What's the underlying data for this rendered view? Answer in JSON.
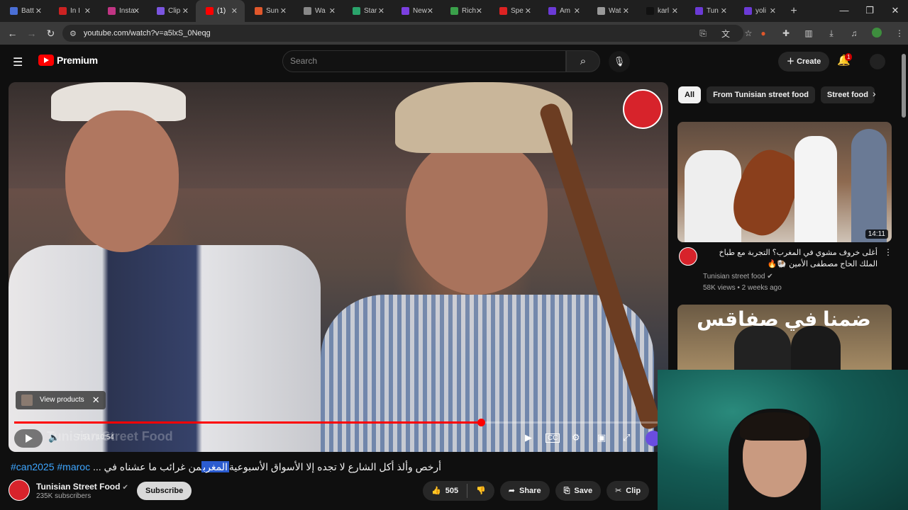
{
  "browser": {
    "tabs": [
      {
        "label": "Batt",
        "color": "#4a6fd6"
      },
      {
        "label": "In I",
        "color": "#cc2222"
      },
      {
        "label": "Insta",
        "color": "#c13584"
      },
      {
        "label": "Clip",
        "color": "#7b55e0"
      },
      {
        "label": "(1)",
        "color": "#ff0000",
        "active": true
      },
      {
        "label": "Sun",
        "color": "#e0572b"
      },
      {
        "label": "Wa",
        "color": "#888888"
      },
      {
        "label": "Star",
        "color": "#2aa36b"
      },
      {
        "label": "New",
        "color": "#7b3fe0"
      },
      {
        "label": "Rich",
        "color": "#3aa04a"
      },
      {
        "label": "Spe",
        "color": "#dd2222"
      },
      {
        "label": "Am",
        "color": "#6b3ad6"
      },
      {
        "label": "Wat",
        "color": "#999999"
      },
      {
        "label": "karl",
        "color": "#111111"
      },
      {
        "label": "Tun",
        "color": "#6b3ad6"
      },
      {
        "label": "yoli",
        "color": "#6b3ad6"
      }
    ],
    "url": "youtube.com/watch?v=a5lxS_0Neqg"
  },
  "youtube": {
    "logo_text": "Premium",
    "search_placeholder": "Search",
    "create_label": "Create",
    "notification_count": "1"
  },
  "player": {
    "channel_logo_text": "Tunisian Street Food",
    "view_products_label": "View products",
    "time_display": "7:51 / 10:54",
    "progress_fraction": 0.72,
    "watermark": "Tunisian Street Food"
  },
  "video": {
    "title_part1": "من غرائب ما عشناه في ",
    "title_highlight": "المغرب",
    "title_part2": " ... أرخص وألذ أكل الشارع لا تجده إلا الأسواق الأسبوعية",
    "hashtags": "#can2025 #maroc",
    "channel_name": "Tunisian Street Food",
    "subscribers": "235K subscribers",
    "subscribe_label": "Subscribe",
    "likes": "505",
    "share_label": "Share",
    "save_label": "Save",
    "clip_label": "Clip"
  },
  "sidebar": {
    "chips": [
      "All",
      "From Tunisian street food",
      "Street food"
    ],
    "videos": [
      {
        "duration": "14:11",
        "title": "أغلى خروف مشوي في المغرب؟ التجربة مع طباخ الملك الحاج مصطفى الأمين 🐏🔥",
        "channel": "Tunisian street food",
        "meta": "58K views • 2 weeks ago"
      },
      {
        "thumb_text": "ضمنا في صفاقس"
      }
    ]
  }
}
